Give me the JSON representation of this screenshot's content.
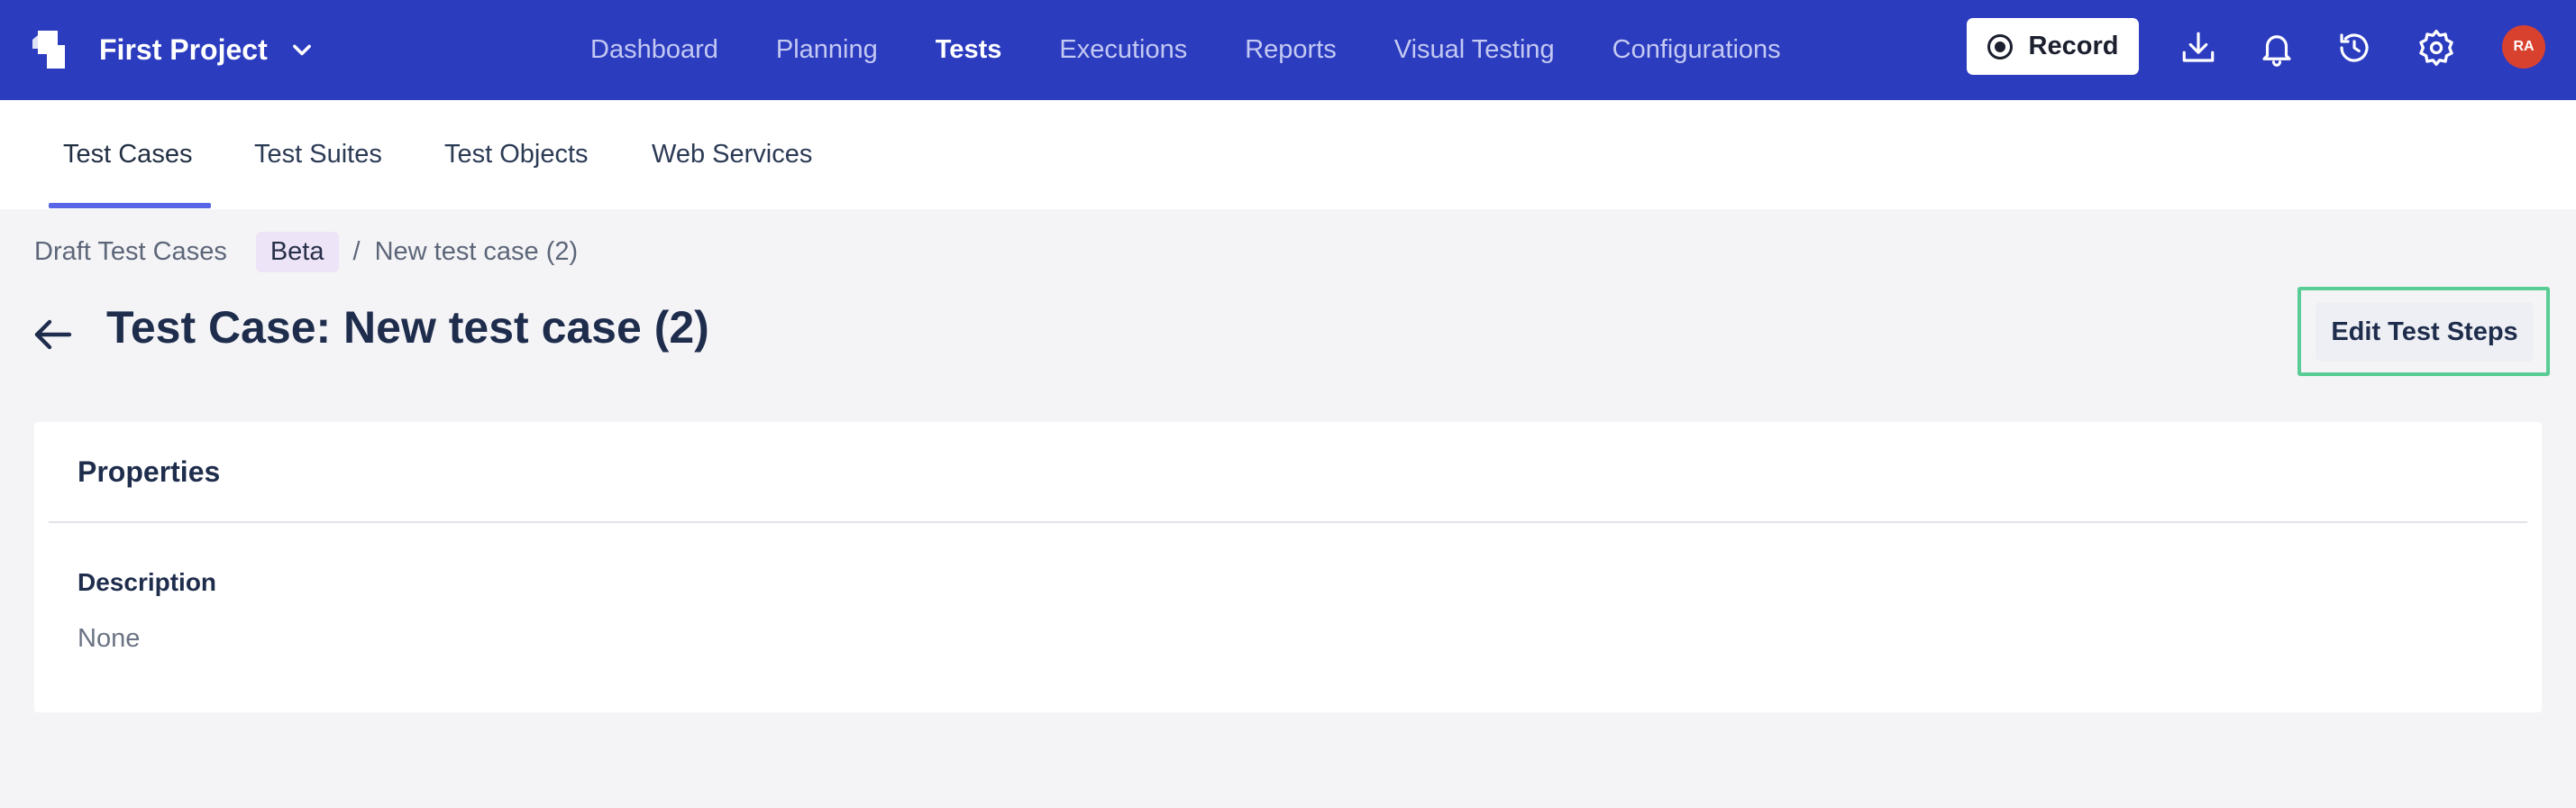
{
  "header": {
    "project_name": "First Project",
    "nav": [
      {
        "label": "Dashboard",
        "active": false
      },
      {
        "label": "Planning",
        "active": false
      },
      {
        "label": "Tests",
        "active": true
      },
      {
        "label": "Executions",
        "active": false
      },
      {
        "label": "Reports",
        "active": false
      },
      {
        "label": "Visual Testing",
        "active": false
      },
      {
        "label": "Configurations",
        "active": false
      }
    ],
    "record_label": "Record",
    "icons": [
      "download-icon",
      "bell-icon",
      "history-icon",
      "gear-icon"
    ],
    "avatar_initials": "RA",
    "brand_color": "#2c3cbf",
    "avatar_color": "#d9412f"
  },
  "subtabs": [
    {
      "label": "Test Cases",
      "active": true
    },
    {
      "label": "Test Suites",
      "active": false
    },
    {
      "label": "Test Objects",
      "active": false
    },
    {
      "label": "Web Services",
      "active": false
    }
  ],
  "breadcrumb": {
    "parent": "Draft Test Cases",
    "badge": "Beta",
    "separator": "/",
    "current": "New test case (2)"
  },
  "page": {
    "title": "Test Case: New test case (2)",
    "edit_button": "Edit Test Steps",
    "highlight_color": "#59cd95"
  },
  "properties": {
    "title": "Properties",
    "description_label": "Description",
    "description_value": "None"
  }
}
